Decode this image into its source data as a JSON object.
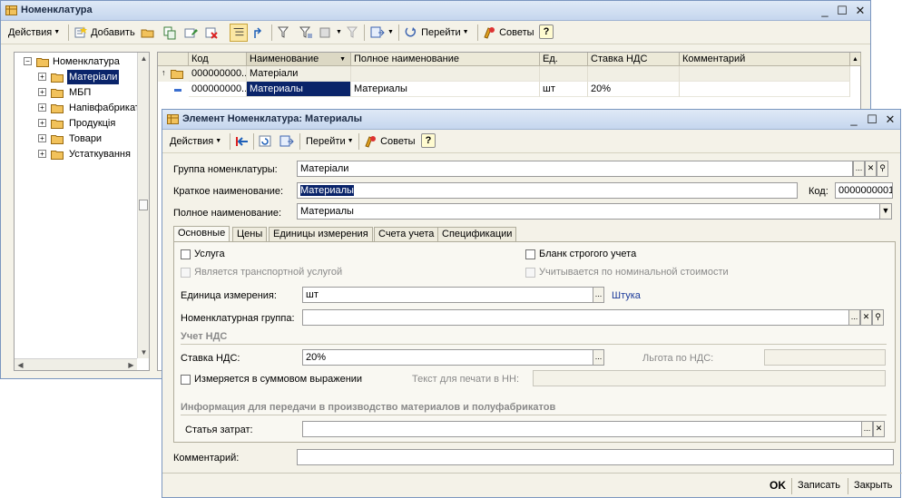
{
  "main_window": {
    "title": "Номенклатура",
    "toolbar": {
      "actions": "Действия",
      "add": "Добавить",
      "goto": "Перейти",
      "tips": "Советы",
      "help": "?"
    },
    "tree": {
      "root": "Номенклатура",
      "items": [
        "Матеріали",
        "МБП",
        "Напівфабрикати",
        "Продукція",
        "Товари",
        "Устаткування"
      ]
    },
    "grid": {
      "columns": [
        "Код",
        "Наименование",
        "Полное наименование",
        "Ед.",
        "Ставка НДС",
        "Комментарий"
      ],
      "rows": [
        {
          "code": "000000000...",
          "name": "Матеріали",
          "full": "",
          "unit": "",
          "vat": "",
          "comment": ""
        },
        {
          "code": "000000000...",
          "name": "Материалы",
          "full": "Материалы",
          "unit": "шт",
          "vat": "20%",
          "comment": ""
        }
      ]
    }
  },
  "element_window": {
    "title": "Элемент Номенклатура: Материалы",
    "toolbar": {
      "actions": "Действия",
      "goto": "Перейти",
      "tips": "Советы",
      "help": "?"
    },
    "group_label": "Группа номенклатуры:",
    "group_value": "Матеріали",
    "short_label": "Краткое наименование:",
    "short_value": "Материалы",
    "code_label": "Код:",
    "code_value": "0000000001",
    "full_label": "Полное наименование:",
    "full_value": "Материалы",
    "tabs": [
      "Основные",
      "Цены",
      "Единицы измерения",
      "Счета учета",
      "Спецификации"
    ],
    "service_label": "Услуга",
    "transport_label": "Является транспортной услугой",
    "strict_label": "Бланк строгого учета",
    "nominal_label": "Учитывается по номинальной стоимости",
    "unit_label": "Единица измерения:",
    "unit_value": "шт",
    "unit_link": "Штука",
    "nomgroup_label": "Номенклатурная группа:",
    "nomgroup_value": "",
    "vat_section": "Учет НДС",
    "vat_label": "Ставка НДС:",
    "vat_value": "20%",
    "vat_benefit_label": "Льгота по НДС:",
    "sum_label": "Измеряется в суммовом выражении",
    "print_label": "Текст для печати в НН:",
    "prod_section": "Информация для передачи в производство материалов и полуфабрикатов",
    "cost_label": "Статья затрат:",
    "cost_value": "",
    "comment_label": "Комментарий:",
    "comment_value": "",
    "buttons": {
      "ok": "OK",
      "save": "Записать",
      "close": "Закрыть"
    }
  }
}
